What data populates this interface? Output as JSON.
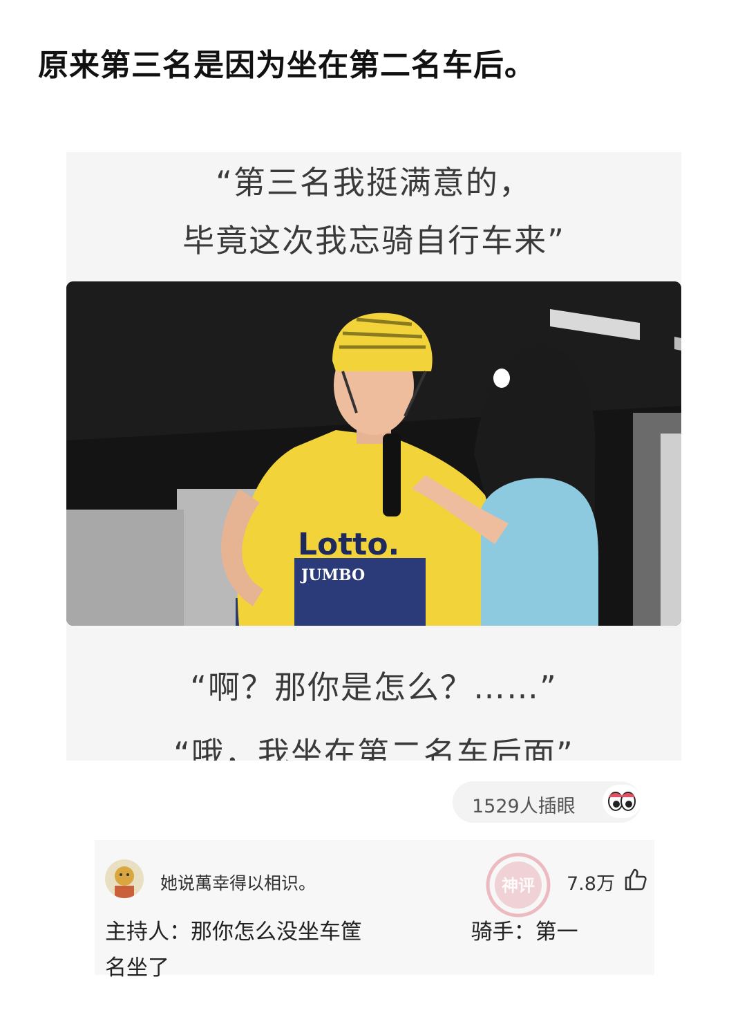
{
  "post": {
    "title": "原来第三名是因为坐在第二名车后。"
  },
  "meme": {
    "quote_line1": "“第三名我挺满意的，",
    "quote_line2": "毕竟这次我忘骑自行车来”",
    "quote_line3": "“啊？那你是怎么？……”",
    "quote_line4": "“哦，我坐在第二名车后面”",
    "jersey_text": "Lotto.",
    "jersey_sub": "JUMBO",
    "photo_icon": "cyclist-interview-photo"
  },
  "reactions": {
    "count_label": "1529人插眼",
    "icon": "eyes-icon"
  },
  "comment": {
    "username": "她说萬幸得以相识。",
    "likes": "7.8万",
    "like_icon": "thumbs-up-icon",
    "text_line1": "主持人：那你怎么没坐车筐                骑手：第一",
    "text_line2": "名坐了",
    "stamp_text": "神评"
  },
  "colors": {
    "jersey_yellow": "#f2d43a",
    "jersey_navy": "#2b3a78",
    "shirt_blue": "#8dc9df",
    "stamp_red": "#e38a96"
  }
}
